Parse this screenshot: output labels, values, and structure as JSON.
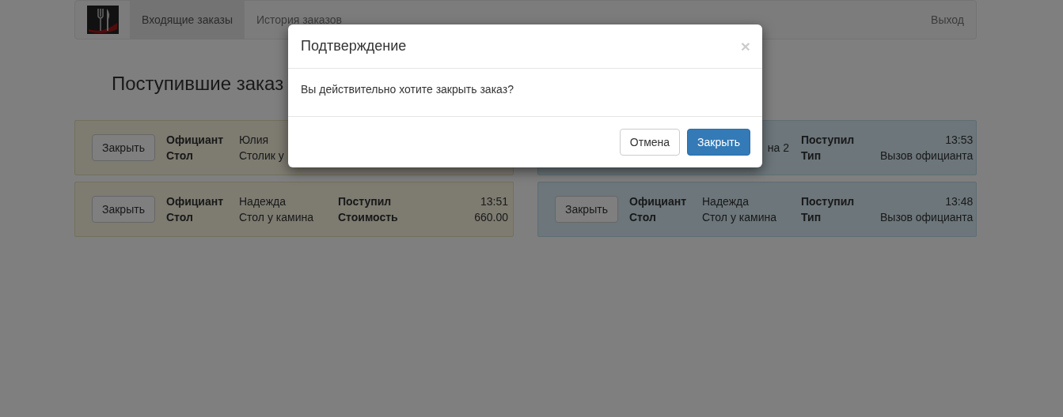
{
  "navbar": {
    "tabs": [
      {
        "label": "Входящие заказы",
        "selected": true
      },
      {
        "label": "История заказов",
        "selected": false
      }
    ],
    "logout": "Выход"
  },
  "heading": "Поступившие заказ",
  "orders": [
    {
      "kind": "warning",
      "button": "Закрыть",
      "fields": [
        {
          "label": "Официант",
          "value": "Юлия"
        },
        {
          "label": "Стол",
          "value": "Столик у"
        }
      ]
    },
    {
      "kind": "info",
      "fields": [
        {
          "value": "на 2",
          "cut": true
        }
      ],
      "details": [
        {
          "label": "Поступил",
          "value": "13:53"
        },
        {
          "label": "Тип",
          "value": "Вызов официанта"
        }
      ]
    },
    {
      "kind": "warning",
      "button": "Закрыть",
      "fields": [
        {
          "label": "Официант",
          "value": "Надежда"
        },
        {
          "label": "Стол",
          "value": "Стол у камина"
        }
      ],
      "details": [
        {
          "label": "Поступил",
          "value": "13:51"
        },
        {
          "label": "Стоимость",
          "value": "660.00"
        }
      ]
    },
    {
      "kind": "info",
      "button": "Закрыть",
      "fields": [
        {
          "label": "Официант",
          "value": "Надежда"
        },
        {
          "label": "Стол",
          "value": "Стол у камина"
        }
      ],
      "details": [
        {
          "label": "Поступил",
          "value": "13:48"
        },
        {
          "label": "Тип",
          "value": "Вызов официанта"
        }
      ]
    }
  ],
  "modal": {
    "title": "Подтверждение",
    "close": "×",
    "message": "Вы действительно хотите закрыть заказ?",
    "buttons": [
      {
        "label": "Отмена",
        "kind": "default"
      },
      {
        "label": "Закрыть",
        "kind": "primary"
      }
    ]
  }
}
